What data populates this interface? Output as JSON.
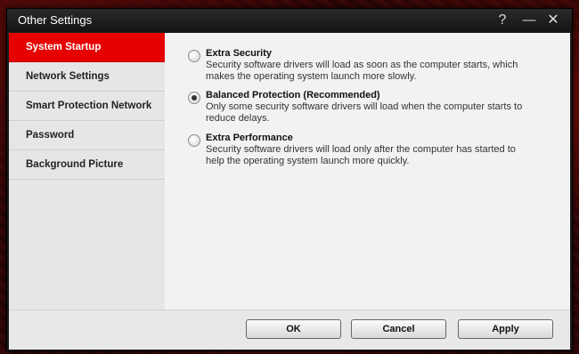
{
  "window": {
    "title": "Other Settings",
    "help_glyph": "?",
    "minimize_glyph": "—",
    "close_glyph": "✕"
  },
  "sidebar": {
    "items": [
      {
        "label": "System Startup",
        "active": true
      },
      {
        "label": "Network Settings",
        "active": false
      },
      {
        "label": "Smart Protection Network",
        "active": false
      },
      {
        "label": "Password",
        "active": false
      },
      {
        "label": "Background Picture",
        "active": false
      }
    ]
  },
  "main": {
    "options": [
      {
        "title": "Extra Security",
        "description": "Security software drivers will load as soon as the computer starts, which makes the operating system launch more slowly.",
        "selected": false
      },
      {
        "title": "Balanced Protection (Recommended)",
        "description": "Only some security software drivers will load when the computer starts to reduce delays.",
        "selected": true
      },
      {
        "title": "Extra Performance",
        "description": "Security software drivers will load only after the computer has started to help the operating system launch more quickly.",
        "selected": false
      }
    ]
  },
  "footer": {
    "ok_label": "OK",
    "cancel_label": "Cancel",
    "apply_label": "Apply"
  },
  "colors": {
    "accent": "#e60000",
    "titlebar": "#1c1c1c",
    "sidebar_bg": "#e6e6e6",
    "content_bg": "#f2f2f2"
  }
}
